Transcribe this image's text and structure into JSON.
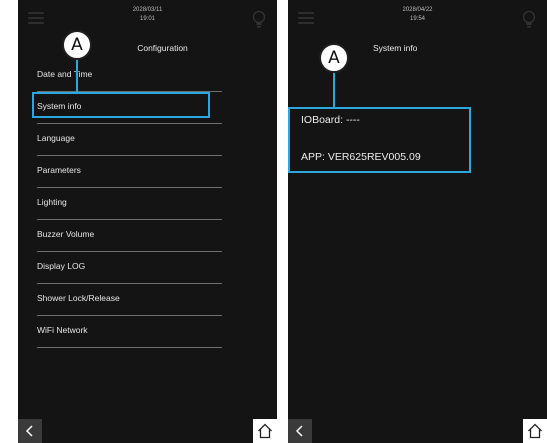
{
  "left_screen": {
    "datetime_date": "2028/03/11",
    "datetime_time": "19:01",
    "title": "Configuration",
    "menu_items": [
      "Date and Time",
      "System info",
      "Language",
      "Parameters",
      "Lighting",
      "Buzzer Volume",
      "Display LOG",
      "Shower Lock/Release",
      "WiFi Network"
    ],
    "selected_item": "System info",
    "callout": "A"
  },
  "right_screen": {
    "datetime_date": "2028/04/22",
    "datetime_time": "19:54",
    "title": "System info",
    "info_lines": [
      "IOBoard: ----",
      "APP: VER625REV005.09"
    ],
    "callout": "A"
  },
  "colors": {
    "screen_bg": "#141414",
    "highlight": "#2aa7df",
    "divider": "#6e6e6e"
  },
  "icons": [
    "menu-icon",
    "bulb-icon",
    "back-arrow-icon",
    "home-icon"
  ]
}
